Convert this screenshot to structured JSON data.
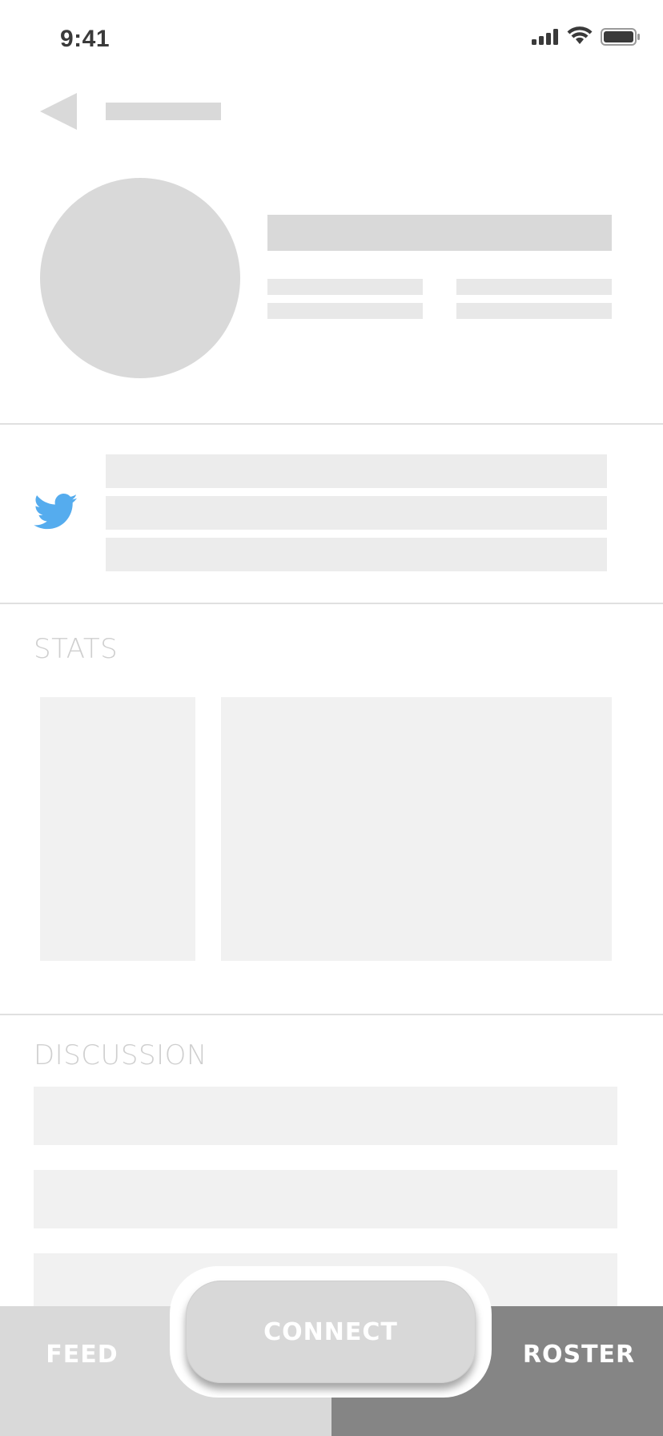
{
  "status_bar": {
    "time": "9:41",
    "icons": [
      "cellular-signal-icon",
      "wifi-icon",
      "battery-icon"
    ]
  },
  "header": {
    "back_icon": "back-arrow-icon"
  },
  "social": {
    "icon": "twitter-icon",
    "color": "#55acee"
  },
  "sections": {
    "stats_label": "STATS",
    "discussion_label": "DISCUSSION"
  },
  "tabbar": {
    "feed_label": "FEED",
    "connect_label": "CONNECT",
    "roster_label": "ROSTER",
    "colors": {
      "feed_bg": "#d9d9d9",
      "roster_bg": "#858585",
      "connect_bg": "#d8d8d8"
    }
  }
}
